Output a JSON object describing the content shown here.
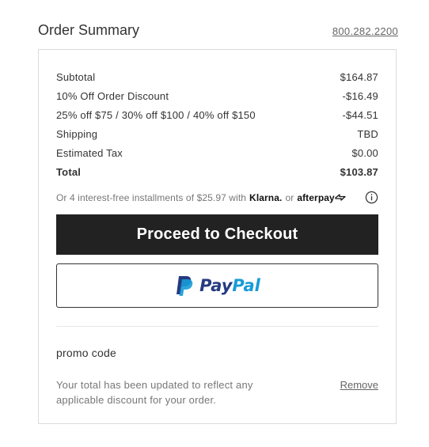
{
  "header": {
    "title": "Order Summary",
    "phone": "800.282.2200"
  },
  "summary": {
    "rows": [
      {
        "label": "Subtotal",
        "value": "$164.87"
      },
      {
        "label": "10% Off Order Discount",
        "value": "-$16.49"
      },
      {
        "label": "25% off $75 / 30% off $100 / 40% off $150",
        "value": "-$44.51"
      },
      {
        "label": "Shipping",
        "value": "TBD"
      },
      {
        "label": "Estimated Tax",
        "value": "$0.00"
      },
      {
        "label": "Total",
        "value": "$103.87"
      }
    ]
  },
  "installments": {
    "text": "Or 4 interest-free installments of $25.97 with",
    "klarna": "Klarna.",
    "or": "or",
    "afterpay": "afterpay"
  },
  "buttons": {
    "checkout": "Proceed to Checkout",
    "paypal_pay": "Pay",
    "paypal_pal": "Pal"
  },
  "promo": {
    "label": "promo code",
    "message": "Your total has been updated to reflect any applicable discount for your order.",
    "remove": "Remove"
  },
  "colors": {
    "checkout_bg": "#222222",
    "paypal_dark": "#253b80",
    "paypal_light": "#179bd7"
  },
  "icons": [
    "info-icon",
    "paypal-logo-icon",
    "afterpay-arrow-icon"
  ]
}
